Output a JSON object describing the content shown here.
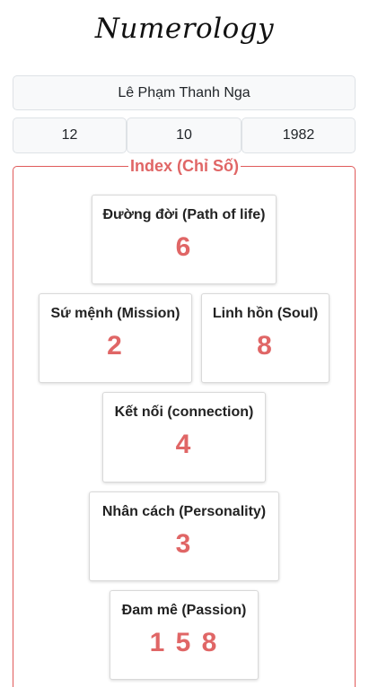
{
  "app": {
    "title": "Numerology"
  },
  "form": {
    "name": "Lê Phạm Thanh Nga",
    "day": "12",
    "month": "10",
    "year": "1982"
  },
  "index_section": {
    "legend": "Index (Chỉ Số)",
    "cards": [
      {
        "label": "Đường đời (Path of life)",
        "value": "6"
      },
      {
        "label": "Sứ mệnh (Mission)",
        "value": "2"
      },
      {
        "label": "Linh hồn (Soul)",
        "value": "8"
      },
      {
        "label": "Kết nối (connection)",
        "value": "4"
      },
      {
        "label": "Nhân cách (Personality)",
        "value": "3"
      },
      {
        "label": "Đam mê (Passion)",
        "value": "1 5 8"
      }
    ]
  },
  "colors": {
    "accent": "#e06666",
    "border": "#e05a5a",
    "input_bg": "#f8f9fa"
  }
}
